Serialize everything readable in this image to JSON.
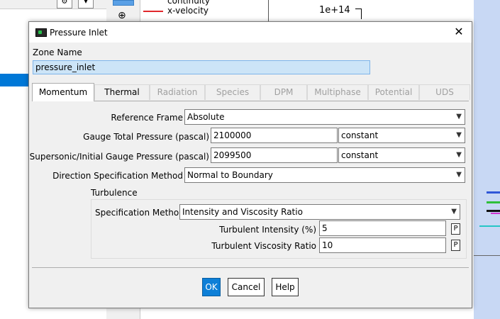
{
  "background": {
    "legend_top": "continuity",
    "legend_series": "x-velocity",
    "legend_color": "#e0282c",
    "y_tick": "1e+14"
  },
  "dialog": {
    "title": "Pressure Inlet",
    "zone_name_label": "Zone Name",
    "zone_name_value": "pressure_inlet",
    "tabs": [
      {
        "label": "Momentum",
        "state": "active"
      },
      {
        "label": "Thermal",
        "state": "enabled"
      },
      {
        "label": "Radiation",
        "state": "disabled"
      },
      {
        "label": "Species",
        "state": "disabled"
      },
      {
        "label": "DPM",
        "state": "disabled"
      },
      {
        "label": "Multiphase",
        "state": "disabled"
      },
      {
        "label": "Potential",
        "state": "disabled"
      },
      {
        "label": "UDS",
        "state": "disabled"
      }
    ],
    "momentum": {
      "reference_frame_label": "Reference Frame",
      "reference_frame_value": "Absolute",
      "gauge_total_pressure_label": "Gauge Total Pressure (pascal)",
      "gauge_total_pressure_value": "2100000",
      "gauge_total_pressure_method": "constant",
      "supersonic_pressure_label": "Supersonic/Initial Gauge Pressure (pascal)",
      "supersonic_pressure_value": "2099500",
      "supersonic_pressure_method": "constant",
      "direction_method_label": "Direction Specification Method",
      "direction_method_value": "Normal to Boundary",
      "turbulence": {
        "title": "Turbulence",
        "spec_method_label": "Specification Method",
        "spec_method_value": "Intensity and Viscosity Ratio",
        "intensity_label": "Turbulent Intensity (%)",
        "intensity_value": "5",
        "viscosity_ratio_label": "Turbulent Viscosity Ratio",
        "viscosity_ratio_value": "10",
        "param_button": "P"
      }
    },
    "buttons": {
      "ok": "OK",
      "cancel": "Cancel",
      "help": "Help"
    },
    "colors": {
      "accent": "#0d7fd7",
      "zone_highlight": "#cce4f7"
    }
  }
}
